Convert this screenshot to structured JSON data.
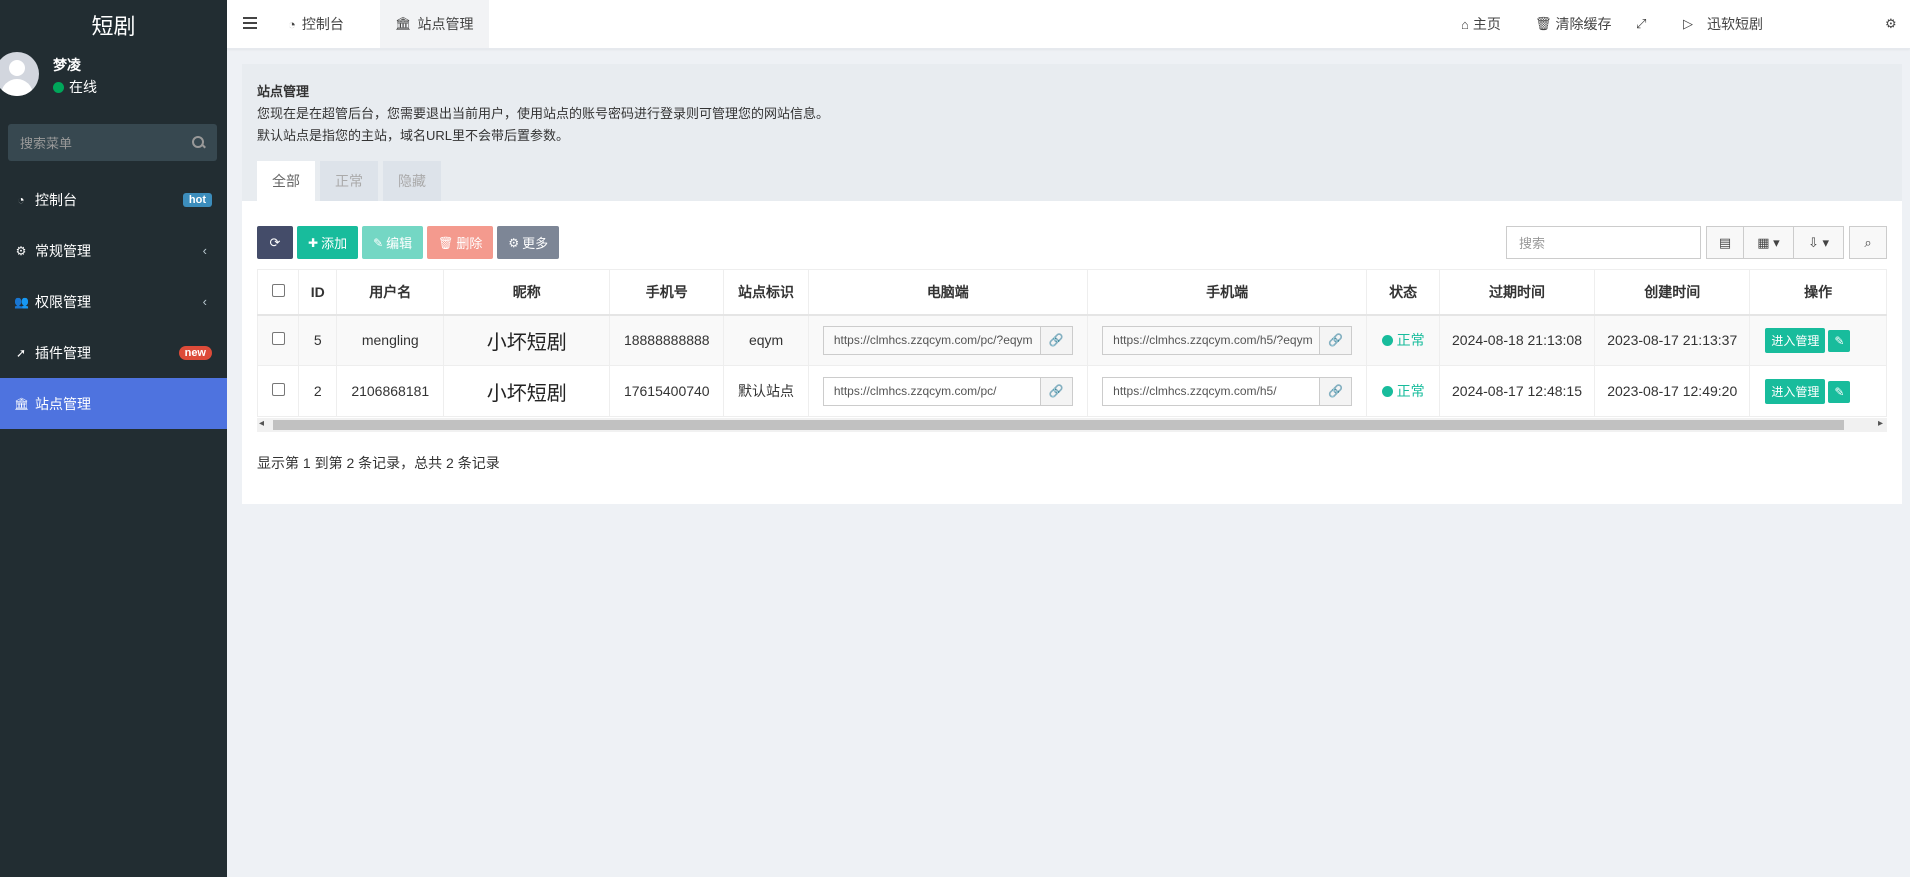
{
  "sidebar": {
    "brand": "短剧",
    "user_name": "梦凌",
    "user_status": "在线",
    "search_placeholder": "搜索菜单",
    "items": [
      {
        "label": "控制台",
        "icon": "dashboard-icon",
        "glyph": "◔",
        "badge": "hot"
      },
      {
        "label": "常规管理",
        "icon": "cogs-icon",
        "glyph": "⚙",
        "chevron": "‹"
      },
      {
        "label": "权限管理",
        "icon": "users-icon",
        "glyph": "👥",
        "chevron": "‹"
      },
      {
        "label": "插件管理",
        "icon": "rocket-icon",
        "glyph": "➚",
        "badge": "new"
      },
      {
        "label": "站点管理",
        "icon": "bank-icon",
        "glyph": "🏛"
      }
    ]
  },
  "topbar": {
    "tabs": [
      {
        "label": "控制台",
        "glyph": "◔"
      },
      {
        "label": "站点管理",
        "glyph": "🏛"
      }
    ],
    "right": [
      {
        "label": "主页",
        "glyph": "⌂"
      },
      {
        "label": "清除缓存",
        "glyph": "🗑"
      },
      {
        "label": "",
        "glyph": "⤢"
      },
      {
        "label": "迅软短剧",
        "glyph": "▷"
      },
      {
        "label": "",
        "glyph": "⚙"
      }
    ]
  },
  "panel": {
    "title": "站点管理",
    "line1": "您现在是在超管后台，您需要退出当前用户，使用站点的账号密码进行登录则可管理您的网站信息。",
    "line2": "默认站点是指您的主站，域名URL里不会带后置参数。",
    "tabs": [
      "全部",
      "正常",
      "隐藏"
    ]
  },
  "toolbar": {
    "refresh_glyph": "⟳",
    "add": "添加",
    "edit": "编辑",
    "delete": "删除",
    "more": "更多",
    "search_placeholder": "搜索"
  },
  "table": {
    "headers": [
      "ID",
      "用户名",
      "昵称",
      "手机号",
      "站点标识",
      "电脑端",
      "手机端",
      "状态",
      "过期时间",
      "创建时间",
      "操作"
    ],
    "rows": [
      {
        "id": "5",
        "username": "mengling",
        "nickname": "小坏短剧",
        "phone": "18888888888",
        "site_id": "eqym",
        "pc_url": "https://clmhcs.zzqcym.com/pc/?eqym",
        "h5_url": "https://clmhcs.zzqcym.com/h5/?eqym",
        "status": "正常",
        "expire": "2024-08-18 21:13:08",
        "created": "2023-08-17 21:13:37",
        "op_enter": "进入管理"
      },
      {
        "id": "2",
        "username": "2106868181",
        "nickname": "小坏短剧",
        "phone": "17615400740",
        "site_id": "默认站点",
        "pc_url": "https://clmhcs.zzqcym.com/pc/",
        "h5_url": "https://clmhcs.zzqcym.com/h5/",
        "status": "正常",
        "expire": "2024-08-17 12:48:15",
        "created": "2023-08-17 12:49:20",
        "op_enter": "进入管理"
      }
    ]
  },
  "pager": "显示第 1 到第 2 条记录，总共 2 条记录",
  "colors": {
    "sidebar_bg": "#222d32",
    "active_menu": "#4e73df",
    "primary": "#18bc9c"
  }
}
